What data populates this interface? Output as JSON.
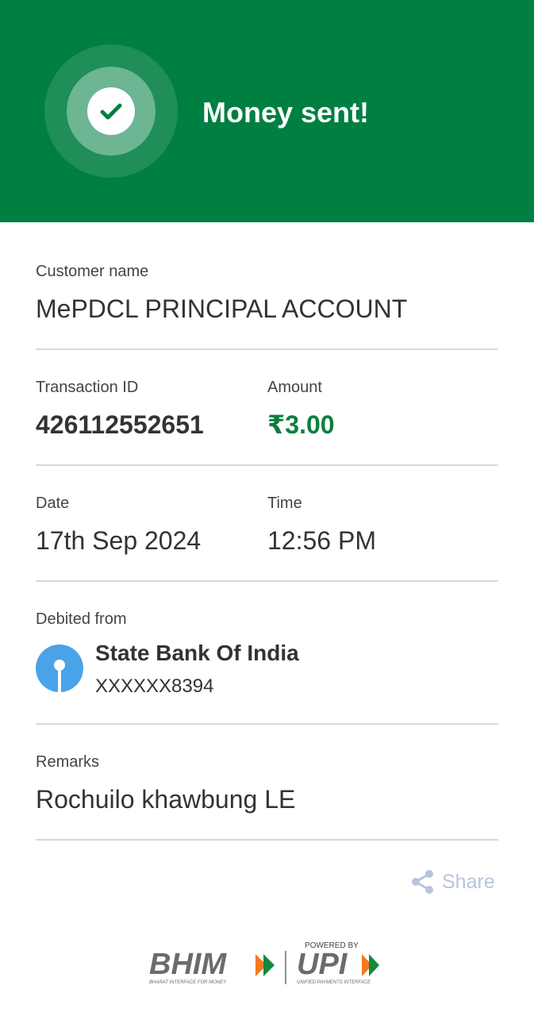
{
  "header": {
    "title": "Money sent!",
    "icon": "check-icon",
    "bg_color": "#007f42"
  },
  "customer": {
    "label": "Customer name",
    "value": "MePDCL PRINCIPAL ACCOUNT"
  },
  "transaction": {
    "id_label": "Transaction ID",
    "id_value": "426112552651",
    "amount_label": "Amount",
    "amount_value": "₹3.00",
    "amount_color": "#0a7f3f"
  },
  "datetime": {
    "date_label": "Date",
    "date_value": "17th Sep 2024",
    "time_label": "Time",
    "time_value": "12:56 PM"
  },
  "debited": {
    "label": "Debited from",
    "bank_name": "State Bank Of India",
    "account": "XXXXXX8394",
    "bank_icon": "sbi-logo-icon"
  },
  "remarks": {
    "label": "Remarks",
    "value": "Rochuilo khawbung LE"
  },
  "share": {
    "label": "Share",
    "icon": "share-icon"
  },
  "footer": {
    "bhim_logo": "BHIM",
    "bhim_tagline": "BHARAT INTERFACE FOR MONEY",
    "powered_by": "POWERED BY",
    "upi_logo": "UPI",
    "upi_tagline": "UNIFIED PAYMENTS INTERFACE"
  }
}
